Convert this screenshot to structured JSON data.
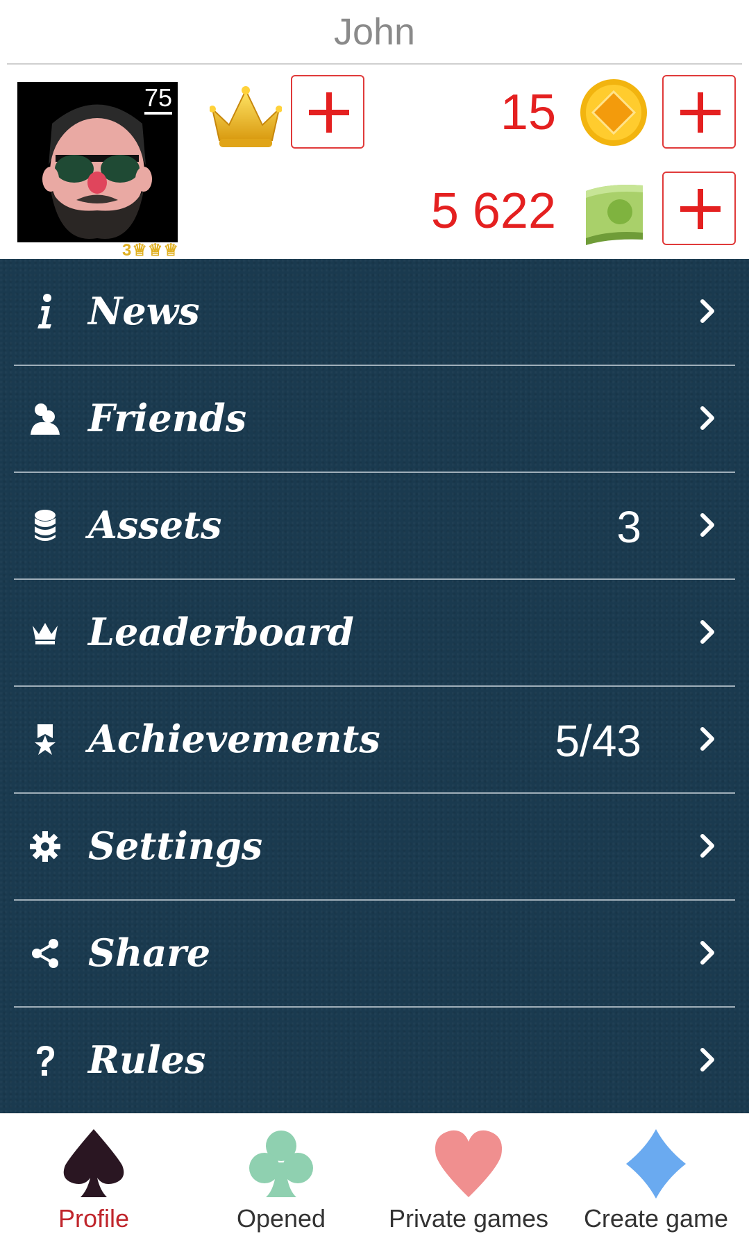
{
  "header": {
    "username": "John"
  },
  "profile": {
    "level": "75",
    "trophies": "3"
  },
  "currency": {
    "coins": "15",
    "cash": "5 622"
  },
  "menu": [
    {
      "label": "News",
      "value": "",
      "icon": "info-icon"
    },
    {
      "label": "Friends",
      "value": "",
      "icon": "friends-icon"
    },
    {
      "label": "Assets",
      "value": "3",
      "icon": "coins-stack-icon"
    },
    {
      "label": "Leaderboard",
      "value": "",
      "icon": "crown-icon"
    },
    {
      "label": "Achievements",
      "value": "5/43",
      "icon": "ribbon-star-icon"
    },
    {
      "label": "Settings",
      "value": "",
      "icon": "gear-icon"
    },
    {
      "label": "Share",
      "value": "",
      "icon": "share-icon"
    },
    {
      "label": "Rules",
      "value": "",
      "icon": "question-icon"
    }
  ],
  "tabs": [
    {
      "label": "Profile",
      "icon": "spade-icon",
      "active": true
    },
    {
      "label": "Opened",
      "icon": "club-icon",
      "active": false
    },
    {
      "label": "Private games",
      "icon": "heart-icon",
      "active": false
    },
    {
      "label": "Create game",
      "icon": "diamond-icon",
      "active": false
    }
  ],
  "colors": {
    "accent_red": "#e42020",
    "menu_bg": "#1a3a4f",
    "active_tab": "#c0262c"
  }
}
